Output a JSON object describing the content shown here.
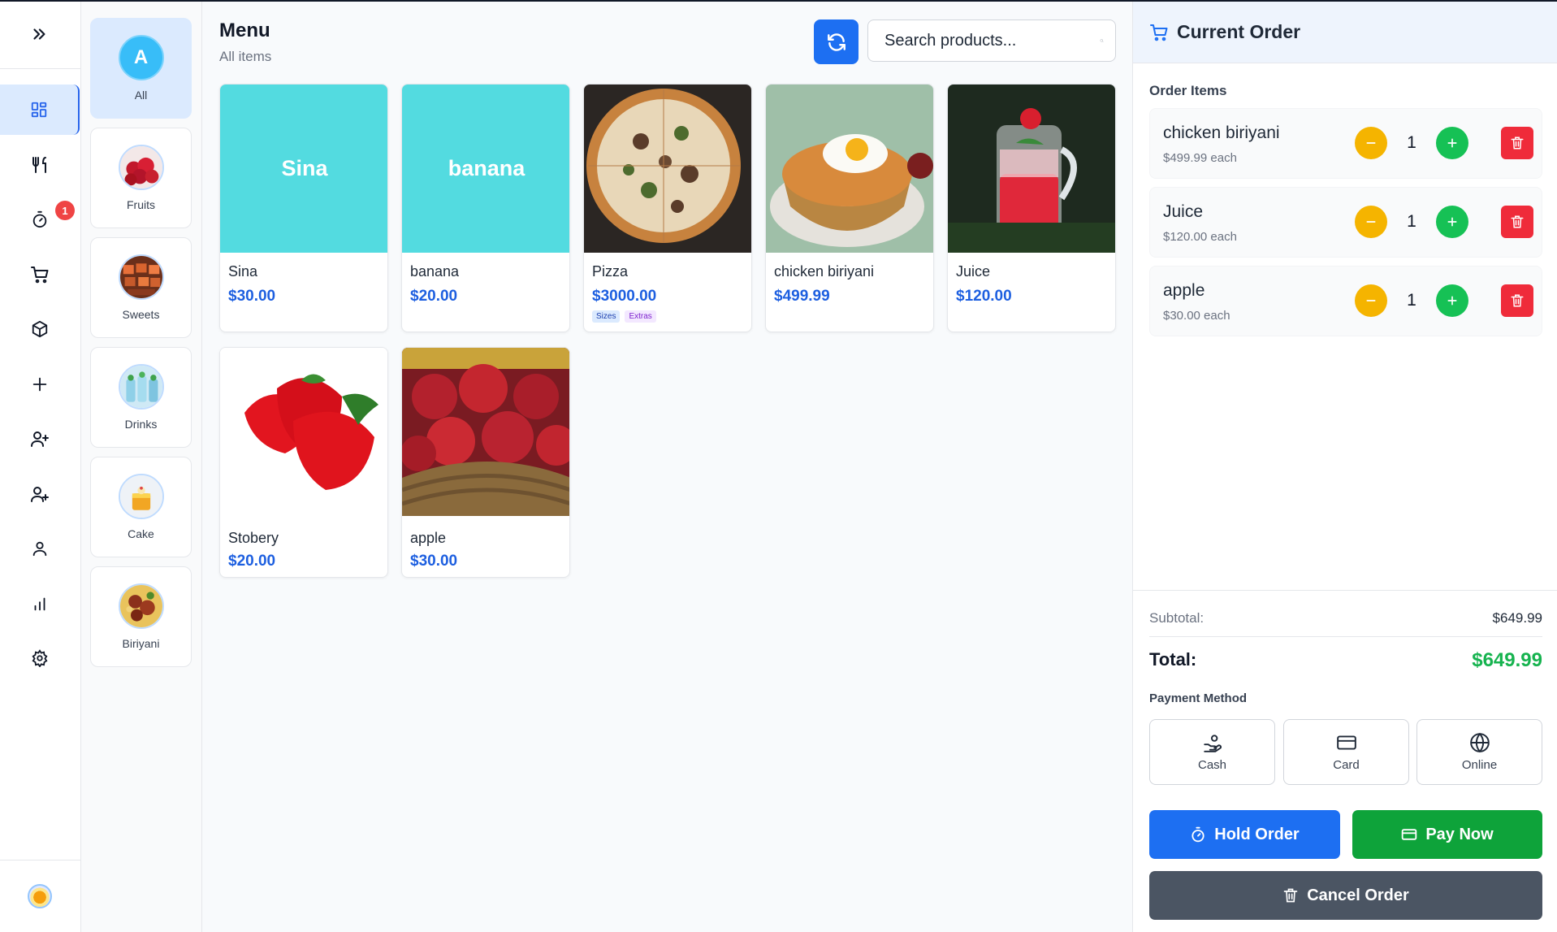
{
  "sidebar": {
    "toggle_icon": "chevrons-right-icon",
    "items": [
      {
        "name": "dashboard",
        "icon": "grid-icon",
        "active": true
      },
      {
        "name": "menu",
        "icon": "utensils-icon"
      },
      {
        "name": "orders",
        "icon": "timer-icon",
        "badge": "1"
      },
      {
        "name": "cart",
        "icon": "cart-icon"
      },
      {
        "name": "products",
        "icon": "box-icon"
      },
      {
        "name": "add",
        "icon": "plus-icon"
      },
      {
        "name": "add-user",
        "icon": "user-plus-icon"
      },
      {
        "name": "add-user-2",
        "icon": "user-plus-icon"
      },
      {
        "name": "profile",
        "icon": "user-icon"
      },
      {
        "name": "reports",
        "icon": "bar-chart-icon"
      },
      {
        "name": "settings",
        "icon": "gear-icon"
      }
    ]
  },
  "categories": [
    {
      "label": "All",
      "initial": "A",
      "active": true
    },
    {
      "label": "Fruits"
    },
    {
      "label": "Sweets"
    },
    {
      "label": "Drinks"
    },
    {
      "label": "Cake"
    },
    {
      "label": "Biriyani"
    }
  ],
  "main": {
    "title": "Menu",
    "subtitle": "All items",
    "search_placeholder": "Search products..."
  },
  "products": [
    {
      "name": "Sina",
      "price": "$30.00",
      "image_text": "Sina"
    },
    {
      "name": "banana",
      "price": "$20.00",
      "image_text": "banana"
    },
    {
      "name": "Pizza",
      "price": "$3000.00",
      "tags": [
        "Sizes",
        "Extras"
      ]
    },
    {
      "name": "chicken biriyani",
      "price": "$499.99"
    },
    {
      "name": "Juice",
      "price": "$120.00"
    },
    {
      "name": "Stobery",
      "price": "$20.00"
    },
    {
      "name": "apple",
      "price": "$30.00"
    }
  ],
  "order": {
    "title": "Current Order",
    "items_label": "Order Items",
    "items": [
      {
        "name": "chicken biriyani",
        "each": "$499.99 each",
        "qty": "1"
      },
      {
        "name": "Juice",
        "each": "$120.00 each",
        "qty": "1"
      },
      {
        "name": "apple",
        "each": "$30.00 each",
        "qty": "1"
      }
    ],
    "subtotal_label": "Subtotal:",
    "subtotal_value": "$649.99",
    "total_label": "Total:",
    "total_value": "$649.99",
    "payment_label": "Payment Method",
    "payment_methods": [
      "Cash",
      "Card",
      "Online"
    ],
    "hold_label": "Hold Order",
    "pay_label": "Pay Now",
    "cancel_label": "Cancel Order"
  },
  "colors": {
    "accent": "#1d6ff2",
    "price": "#1d5fe0",
    "total": "#16b34f",
    "minus": "#f5b400",
    "plus": "#16c155",
    "delete": "#ef2b3a",
    "tile": "#53dbe0"
  }
}
